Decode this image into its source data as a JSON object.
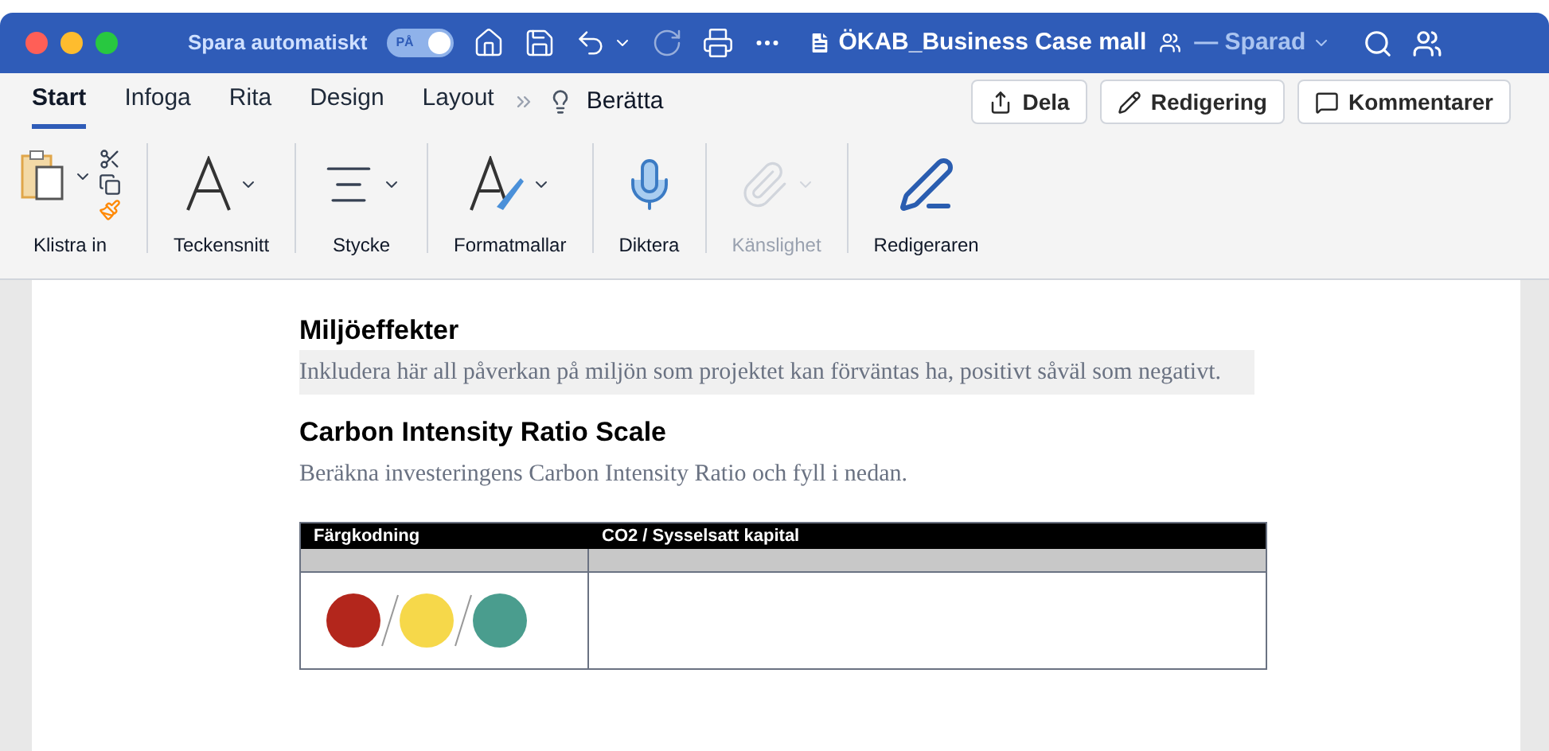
{
  "title_bar": {
    "autosave_label": "Spara automatiskt",
    "autosave": {
      "on": true,
      "label": "PÅ"
    },
    "document_title": "ÖKAB_Business Case mall",
    "save_status": "— Sparad"
  },
  "tabs": [
    {
      "label": "Start",
      "selected": true
    },
    {
      "label": "Infoga",
      "selected": false
    },
    {
      "label": "Rita",
      "selected": false
    },
    {
      "label": "Design",
      "selected": false
    },
    {
      "label": "Layout",
      "selected": false
    }
  ],
  "tell_me": "Berätta",
  "actions": [
    {
      "kind": "share",
      "label": "Dela"
    },
    {
      "kind": "editing",
      "label": "Redigering"
    },
    {
      "kind": "comments",
      "label": "Kommentarer"
    }
  ],
  "ribbon": [
    {
      "kind": "paste",
      "label": "Klistra in",
      "disabled": false
    },
    {
      "kind": "font",
      "label": "Teckensnitt",
      "disabled": false
    },
    {
      "kind": "paragraph",
      "label": "Stycke",
      "disabled": false
    },
    {
      "kind": "styles",
      "label": "Formatmallar",
      "disabled": false
    },
    {
      "kind": "dictate",
      "label": "Diktera",
      "disabled": false
    },
    {
      "kind": "sensitivity",
      "label": "Känslighet",
      "disabled": true
    },
    {
      "kind": "editor",
      "label": "Redigeraren",
      "disabled": false
    }
  ],
  "document": {
    "sections": [
      {
        "heading": "Miljöeffekter",
        "text": "Inkludera här all påverkan på miljön som projektet kan förväntas ha, positivt såväl som negativt.",
        "highlighted": true
      },
      {
        "heading": "Carbon Intensity Ratio Scale",
        "text": "Beräkna investeringens Carbon Intensity Ratio och fyll i nedan.",
        "highlighted": false
      }
    ],
    "table": {
      "columns": [
        "Färgkodning",
        "CO2 / Sysselsatt kapital"
      ],
      "dots": [
        {
          "color": "#b3261c"
        },
        {
          "color": "#f6d84a"
        },
        {
          "color": "#4a9d8e"
        }
      ]
    }
  }
}
